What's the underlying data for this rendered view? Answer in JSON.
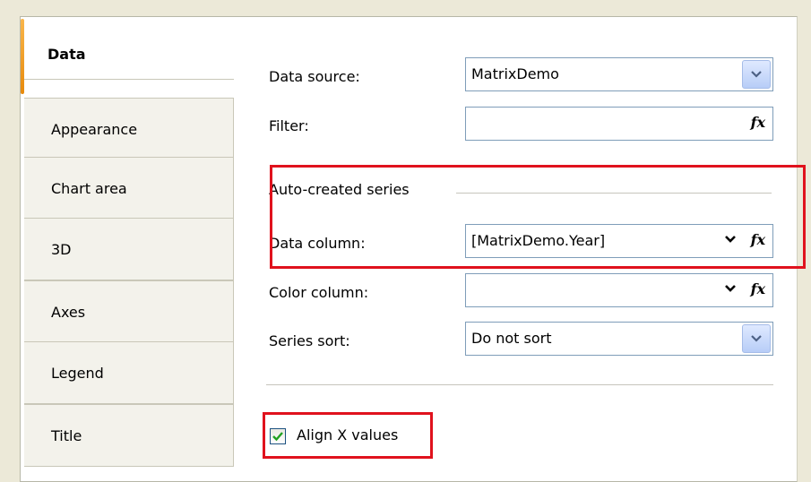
{
  "tabs": [
    {
      "label": "Data",
      "active": true
    },
    {
      "label": "Appearance"
    },
    {
      "label": "Chart area"
    },
    {
      "label": "3D"
    },
    {
      "label": "Axes"
    },
    {
      "label": "Legend"
    },
    {
      "label": "Title"
    }
  ],
  "form": {
    "data_source": {
      "label": "Data source:",
      "value": "MatrixDemo"
    },
    "filter": {
      "label": "Filter:",
      "value": ""
    },
    "group": {
      "title": "Auto-created series"
    },
    "data_column": {
      "label": "Data column:",
      "value": "[MatrixDemo.Year]"
    },
    "color_column": {
      "label": "Color column:",
      "value": ""
    },
    "series_sort": {
      "label": "Series sort:",
      "value": "Do not sort"
    },
    "align_x": {
      "label": "Align X values",
      "checked": true
    }
  },
  "icons": {
    "expression": "fx",
    "combo_arrow": "chevron-down-icon"
  },
  "colors": {
    "highlight": "#e0121d",
    "active_tab_accent": "#f3a531",
    "field_border": "#7f9db9"
  }
}
